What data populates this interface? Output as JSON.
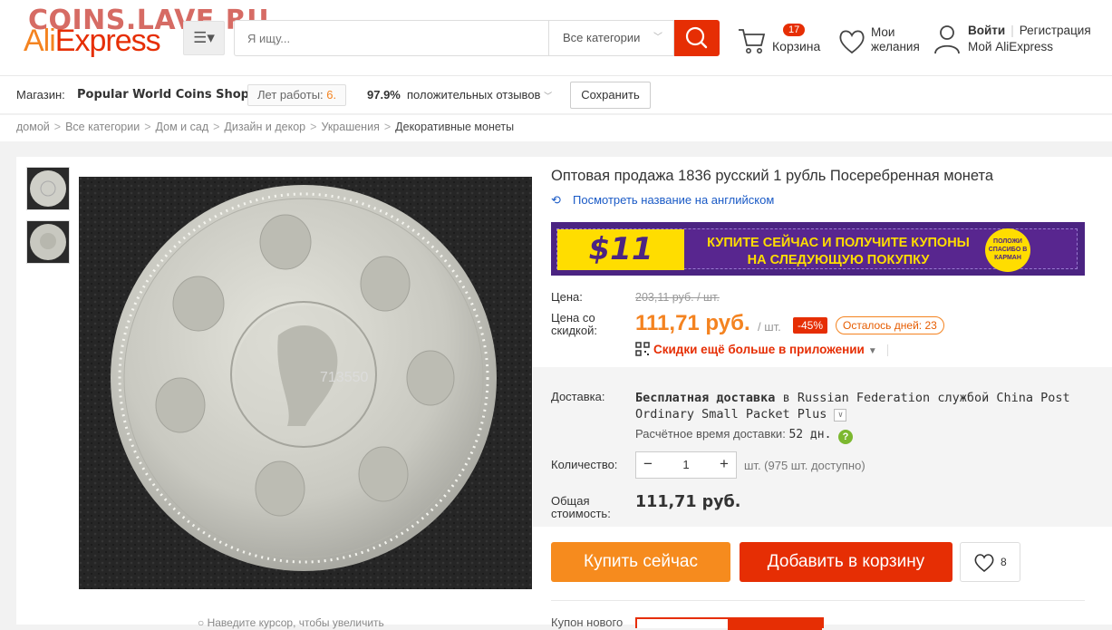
{
  "watermark": "COINS.LAVE.RU",
  "header": {
    "logo_part1": "Ali",
    "logo_part2": "Express",
    "menu_icon": "hamburger-icon",
    "search_placeholder": "Я ищу...",
    "category_select": "Все категории",
    "cart_count": "17",
    "cart_label": "Корзина",
    "wishlist_line1": "Мои",
    "wishlist_line2": "желания",
    "login": "Войти",
    "register": "Регистрация",
    "my_account": "Мой AliExpress"
  },
  "store_bar": {
    "store_label": "Магазин:",
    "store_name": "Popular World Coins Shop",
    "years_label": "Лет работы:",
    "years_value": "6",
    "feedback_percent": "97.9%",
    "feedback_label": "положительных отзывов",
    "save_button": "Сохранить"
  },
  "breadcrumb": [
    "домой",
    "Все категории",
    "Дом и сад",
    "Дизайн и декор",
    "Украшения",
    "Декоративные монеты"
  ],
  "gallery": {
    "main_image_caption": "713550",
    "hint": "Наведите курсор, чтобы увеличить"
  },
  "product": {
    "title": "Оптовая продажа 1836 русский 1 рубль Посеребренная монета",
    "translate_link": "Посмотреть название на английском",
    "banner_amount": "$11",
    "banner_line1": "КУПИТЕ СЕЙЧАС И ПОЛУЧИТЕ КУПОНЫ",
    "banner_line2": "НА СЛЕДУЮЩУЮ ПОКУПКУ",
    "banner_badge": "ПОЛОЖИ СПАСИБО В КАРМАН",
    "price_label": "Цена:",
    "old_price": "203,11 руб. / шт.",
    "discount_price_label_1": "Цена со",
    "discount_price_label_2": "скидкой:",
    "price": "111,71 руб.",
    "unit": "/ шт.",
    "discount": "-45%",
    "days_left": "Осталось дней: 23",
    "app_deal": "Скидки ещё больше в приложении",
    "shipping_label": "Доставка:",
    "shipping_free": "Бесплатная доставка",
    "shipping_to_word": "в",
    "shipping_country": "Russian Federation",
    "shipping_service_word": "службой",
    "shipping_service": "China Post Ordinary Small Packet Plus",
    "eta_label": "Расчётное время доставки:",
    "eta_value": "52 дн.",
    "qty_label": "Количество:",
    "qty_value": "1",
    "availability": "шт. (975 шт. доступно)",
    "total_label_1": "Общая",
    "total_label_2": "стоимость:",
    "total": "111,71 руб.",
    "buy_now": "Купить сейчас",
    "add_to_cart": "Добавить в корзину",
    "wishlist_count": "8",
    "coupon_label": "Купон нового"
  }
}
